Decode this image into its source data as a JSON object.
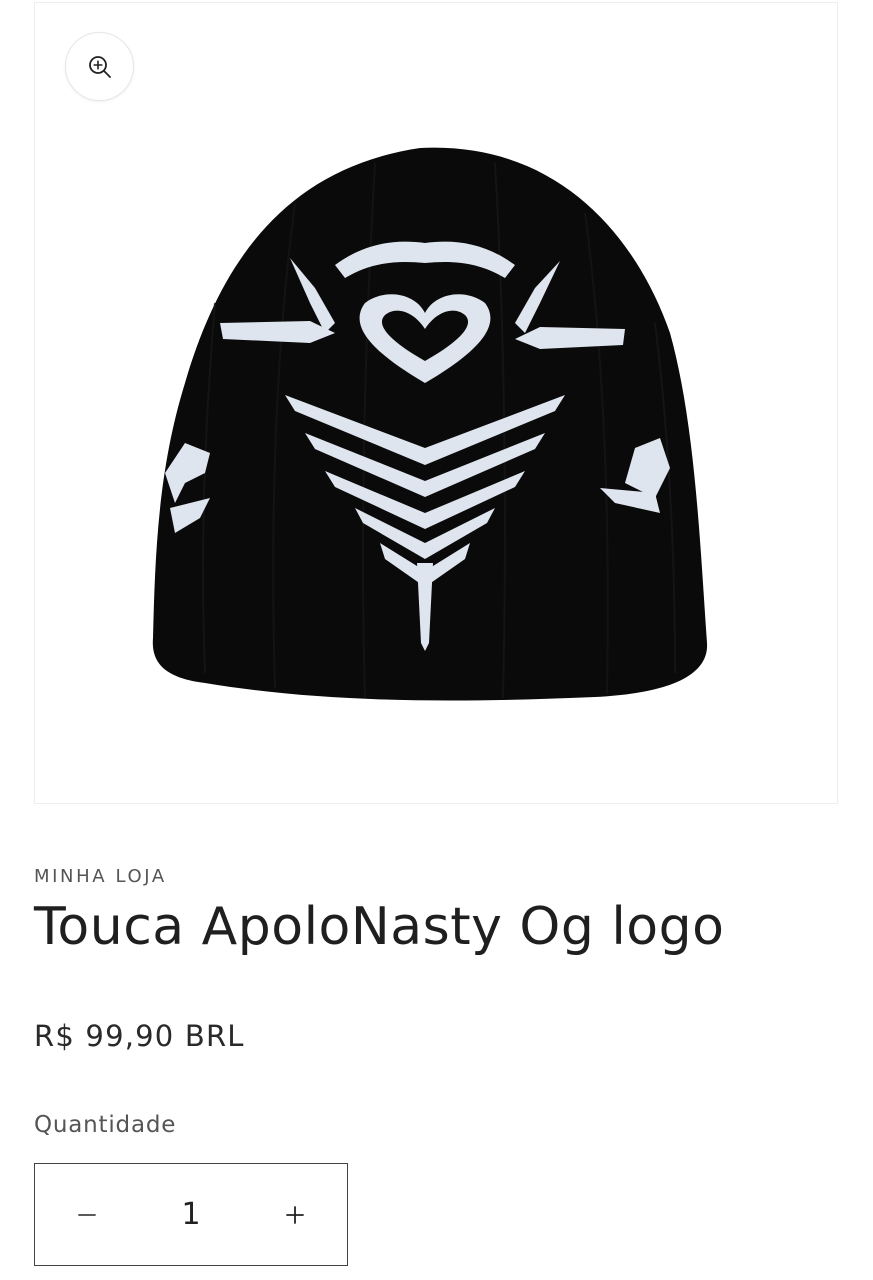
{
  "product": {
    "vendor": "MINHA LOJA",
    "title": "Touca ApoloNasty Og logo",
    "price": "R$ 99,90 BRL",
    "image_alt": "Touca preta com logo tribal branco"
  },
  "quantity": {
    "label": "Quantidade",
    "value": "1",
    "decrease_icon": "minus-icon",
    "increase_icon": "plus-icon"
  },
  "icons": {
    "zoom": "zoom-in-icon"
  },
  "colors": {
    "beanie": "#0a0a0a",
    "pattern": "#dfe5ee",
    "text": "#222222",
    "muted": "#555555"
  }
}
